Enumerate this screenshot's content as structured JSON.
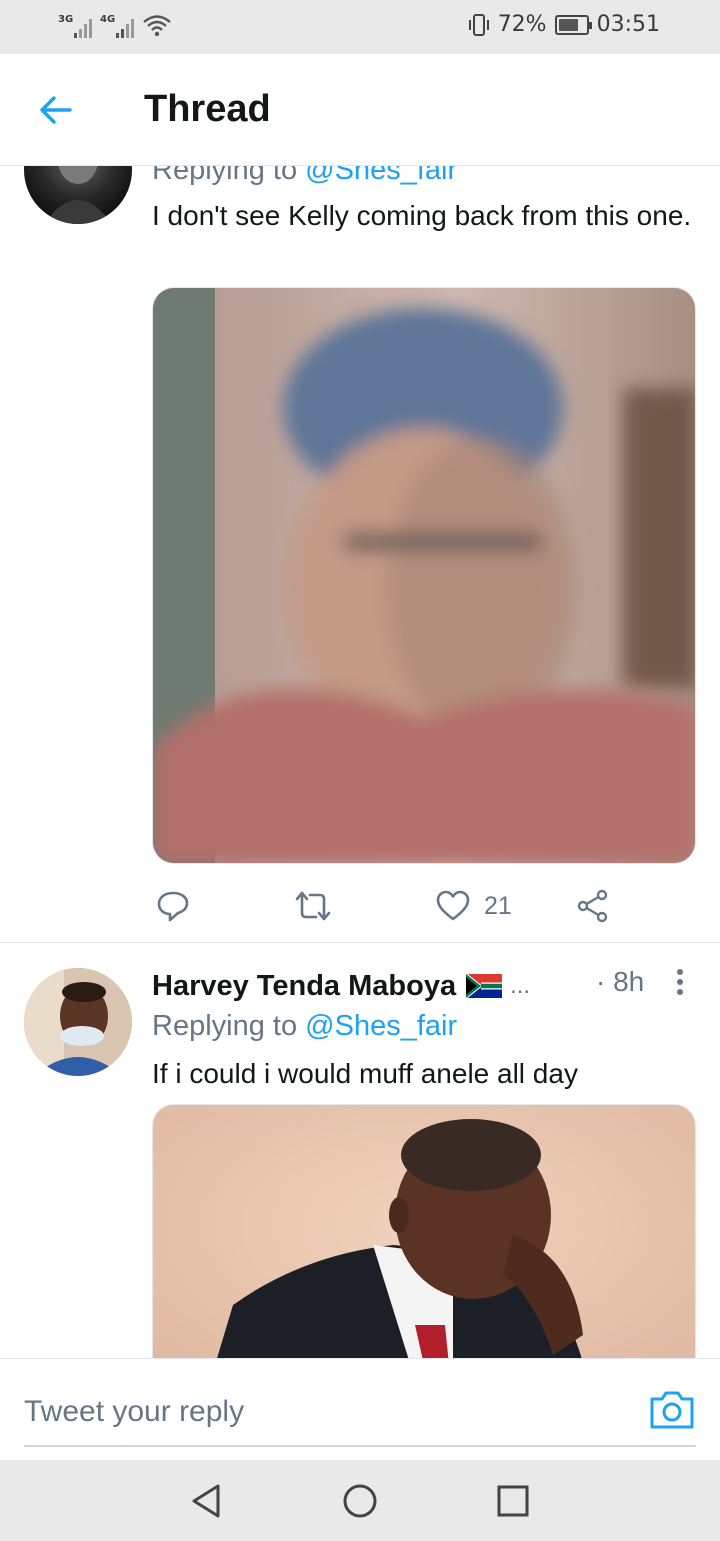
{
  "status_bar": {
    "net1": "3G",
    "net2": "4G",
    "battery": "72%",
    "battery_level": 0.72,
    "time": "03:51"
  },
  "header": {
    "title": "Thread",
    "back_icon": "arrow-left-icon"
  },
  "tweets": [
    {
      "replying_prefix": "Replying to ",
      "replying_handle": "@Shes_fair",
      "text": "I don't see Kelly coming back from this one.",
      "has_media": true,
      "actions": {
        "reply_icon": "reply-icon",
        "retweet_icon": "retweet-icon",
        "like_icon": "heart-icon",
        "like_count": "21",
        "share_icon": "share-icon"
      }
    },
    {
      "author_name": "Harvey Tenda Maboya",
      "flag": "south-africa-flag-icon",
      "ellipsis": "...",
      "time": "· 8h",
      "replying_prefix": "Replying to ",
      "replying_handle": "@Shes_fair",
      "text": "If i could i would muff anele all day",
      "has_media": true
    }
  ],
  "reply_bar": {
    "placeholder": "Tweet your reply",
    "camera_icon": "camera-icon"
  },
  "nav_bar": {
    "back_icon": "triangle-back-icon",
    "home_icon": "circle-home-icon",
    "recents_icon": "square-recents-icon"
  },
  "colors": {
    "accent": "#1da1f2",
    "secondary_text": "#657786",
    "primary_text": "#14171a"
  }
}
